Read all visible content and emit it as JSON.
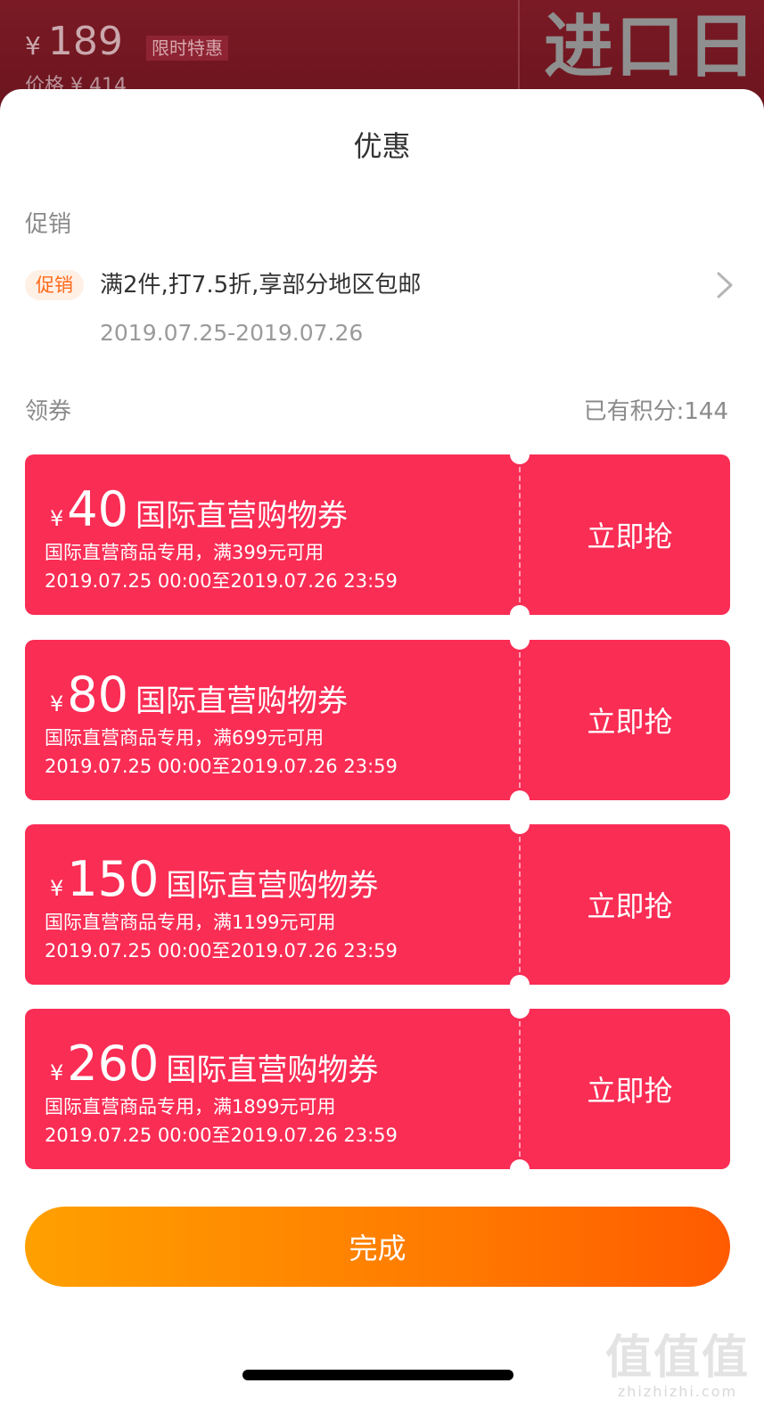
{
  "background": {
    "price_symbol": "¥",
    "price": "189",
    "badge": "限时特惠",
    "original_price": "价格 ¥ 414",
    "logo_text": "进口日"
  },
  "sheet": {
    "title": "优惠",
    "promo_section_label": "促销",
    "promo": {
      "tag": "促销",
      "text": "满2件,打7.5折,享部分地区包邮",
      "date": "2019.07.25-2019.07.26"
    },
    "coupon_section_label": "领券",
    "points_text": "已有积分:144",
    "coupons": [
      {
        "symbol": "¥",
        "amount": "40",
        "title": "国际直营购物券",
        "condition": "国际直营商品专用，满399元可用",
        "period": "2019.07.25 00:00至2019.07.26 23:59",
        "button": "立即抢"
      },
      {
        "symbol": "¥",
        "amount": "80",
        "title": "国际直营购物券",
        "condition": "国际直营商品专用，满699元可用",
        "period": "2019.07.25 00:00至2019.07.26 23:59",
        "button": "立即抢"
      },
      {
        "symbol": "¥",
        "amount": "150",
        "title": "国际直营购物券",
        "condition": "国际直营商品专用，满1199元可用",
        "period": "2019.07.25 00:00至2019.07.26 23:59",
        "button": "立即抢"
      },
      {
        "symbol": "¥",
        "amount": "260",
        "title": "国际直营购物券",
        "condition": "国际直营商品专用，满1899元可用",
        "period": "2019.07.25 00:00至2019.07.26 23:59",
        "button": "立即抢"
      }
    ],
    "done_button": "完成"
  },
  "watermark": {
    "big": "值值值",
    "small": "zhizhizhi.com"
  },
  "colors": {
    "coupon": "#fa2d55",
    "promo_tag": "#ff6a1a",
    "done_start": "#ffa000",
    "done_end": "#ff5a00"
  }
}
